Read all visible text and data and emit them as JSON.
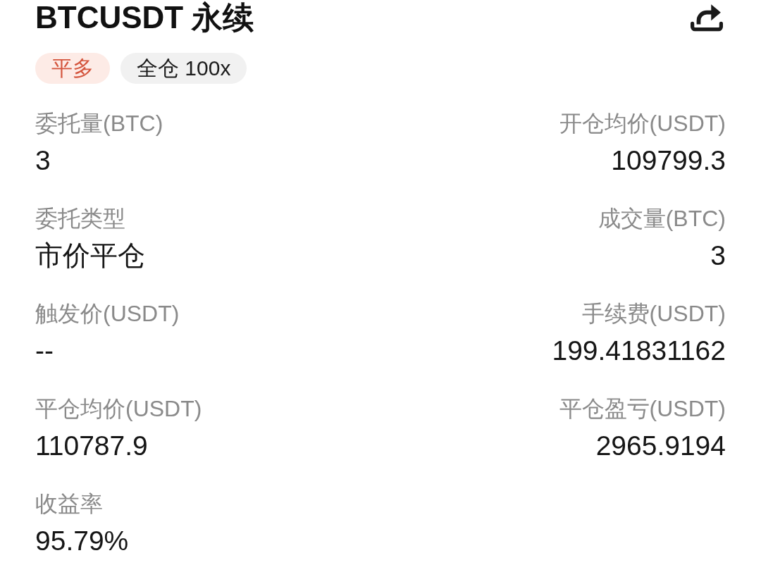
{
  "header": {
    "title": "BTCUSDT 永续",
    "tags": [
      {
        "kind": "side",
        "label": "平多"
      },
      {
        "kind": "margin",
        "label": "全仓 100x"
      }
    ]
  },
  "fields": [
    {
      "label": "委托量(BTC)",
      "value": "3"
    },
    {
      "label": "开仓均价(USDT)",
      "value": "109799.3"
    },
    {
      "label": "委托类型",
      "value": "市价平仓"
    },
    {
      "label": "成交量(BTC)",
      "value": "3"
    },
    {
      "label": "触发价(USDT)",
      "value": "--"
    },
    {
      "label": "手续费(USDT)",
      "value": "199.41831162"
    },
    {
      "label": "平仓均价(USDT)",
      "value": "110787.9"
    },
    {
      "label": "平仓盈亏(USDT)",
      "value": "2965.9194"
    },
    {
      "label": "收益率",
      "value": "95.79%"
    }
  ]
}
